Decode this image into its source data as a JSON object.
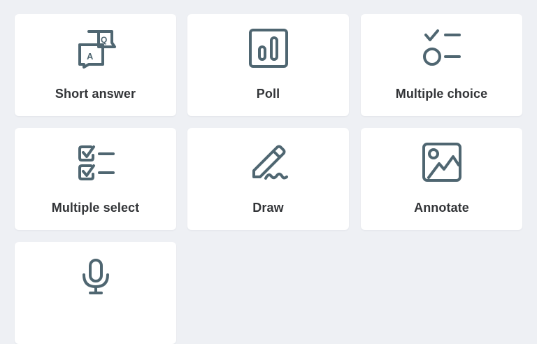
{
  "colors": {
    "background": "#eef0f4",
    "card": "#ffffff",
    "icon": "#4f6671",
    "label": "#333538"
  },
  "cards": [
    {
      "id": "short-answer",
      "label": "Short answer",
      "icon": "qa-bubble-icon"
    },
    {
      "id": "poll",
      "label": "Poll",
      "icon": "poll-chart-icon"
    },
    {
      "id": "multiple-choice",
      "label": "Multiple choice",
      "icon": "multiple-choice-icon"
    },
    {
      "id": "multiple-select",
      "label": "Multiple select",
      "icon": "checklist-icon"
    },
    {
      "id": "draw",
      "label": "Draw",
      "icon": "pencil-icon"
    },
    {
      "id": "annotate",
      "label": "Annotate",
      "icon": "image-icon"
    },
    {
      "id": "audio",
      "label": "",
      "icon": "microphone-icon"
    }
  ]
}
